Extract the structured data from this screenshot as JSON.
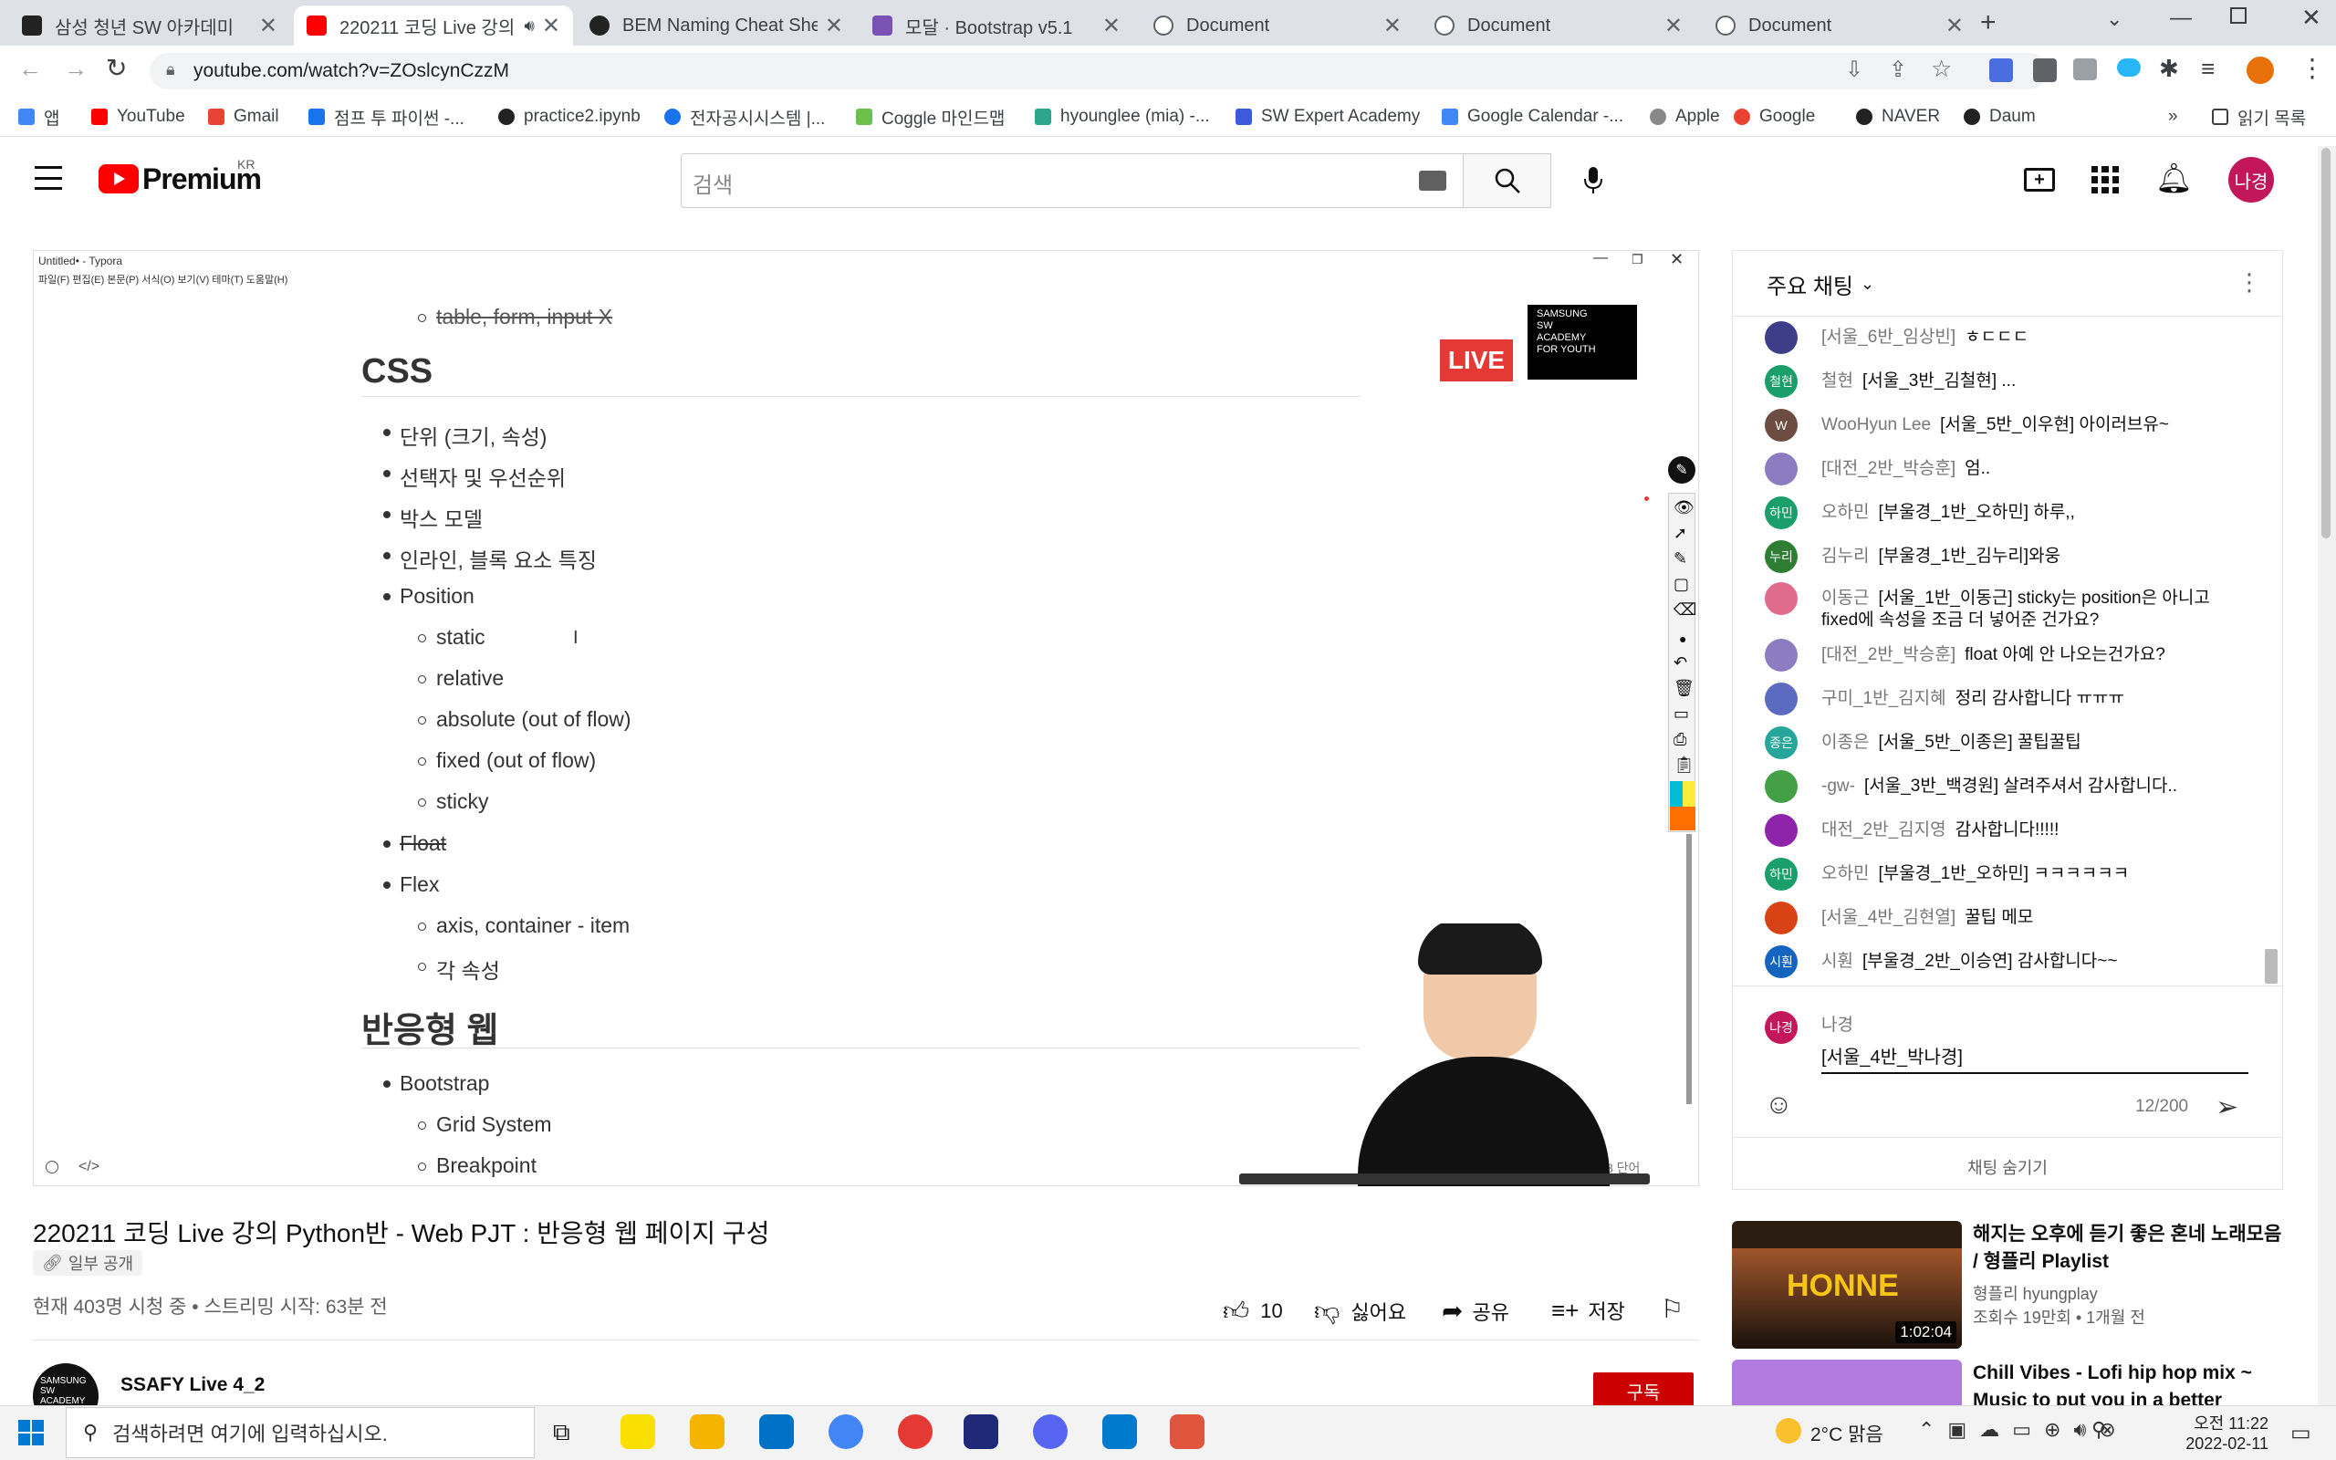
{
  "browser": {
    "tabs": [
      {
        "title": "삼성 청년 SW 아카데미",
        "color": "#222"
      },
      {
        "title": "220211 코딩 Live 강의",
        "color": "#f00"
      },
      {
        "title": "BEM Naming Cheat Shee",
        "color": "#222"
      },
      {
        "title": "모달 · Bootstrap v5.1",
        "color": "#7952b3"
      },
      {
        "title": "Document",
        "color": "#5f6368"
      },
      {
        "title": "Document",
        "color": "#5f6368"
      },
      {
        "title": "Document",
        "color": "#5f6368"
      }
    ],
    "url": "youtube.com/watch?v=ZOslcynCzzM",
    "bookmarks": [
      {
        "label": "앱",
        "color": "#4285f4"
      },
      {
        "label": "YouTube",
        "color": "#f00"
      },
      {
        "label": "Gmail",
        "color": "#ea4335"
      },
      {
        "label": "점프 투 파이썬 -...",
        "color": "#1a73e8"
      },
      {
        "label": "practice2.ipynb",
        "color": "#222"
      },
      {
        "label": "전자공시시스템 |...",
        "color": "#1a73e8"
      },
      {
        "label": "Coggle 마인드맵",
        "color": "#6cc04a"
      },
      {
        "label": "hyounglee (mia) -...",
        "color": "#2ca58d"
      },
      {
        "label": "SW Expert Academy",
        "color": "#3b5bdb"
      },
      {
        "label": "Google Calendar -...",
        "color": "#4285f4"
      },
      {
        "label": "Apple",
        "color": "#888"
      },
      {
        "label": "Google",
        "color": "#ea4335"
      },
      {
        "label": "NAVER",
        "color": "#222"
      },
      {
        "label": "Daum",
        "color": "#222"
      }
    ],
    "reading_list": "읽기 목록",
    "more": "»"
  },
  "youtube": {
    "logo": "Premium",
    "region": "KR",
    "search_placeholder": "검색",
    "avatar": "나경"
  },
  "typora": {
    "title": "Untitled• - Typora",
    "menu": "파일(F)  편집(E)  본문(P)  서식(O)  보기(V)  테마(T)  도움말(H)",
    "lines": {
      "strike1": "table, form, input X",
      "css": "CSS",
      "l1": "단위 (크기, 속성)",
      "l2": "선택자 및 우선순위",
      "l3": "박스 모델",
      "l4": "인라인, 블록 요소 특징",
      "l5": "Position",
      "l5a": "static",
      "l5b": "relative",
      "l5c": "absolute (out of flow)",
      "l5d": "fixed (out of flow)",
      "l5e": "sticky",
      "l6": "Float",
      "l7": "Flex",
      "l7a": "axis, container - item",
      "l7b": "각 속성",
      "resp": "반응형 웹",
      "r1": "Bootstrap",
      "r1a": "Grid System",
      "r1b": "Breakpoint"
    },
    "word_count": "8 단어",
    "live_badge": "LIVE",
    "academy_logo": "SAMSUNG SW ACADEMY FOR YOUTH"
  },
  "video": {
    "title": "220211 코딩 Live 강의 Python반 - Web PJT : 반응형 웹 페이지 구성",
    "visibility": "일부 공개",
    "stats": "현재 403명 시청 중 • 스트리밍 시작: 63분 전",
    "likes": "10",
    "dislike": "싫어요",
    "share": "공유",
    "save": "저장",
    "channel": "SSAFY Live 4_2",
    "subscribe": "구독"
  },
  "chat": {
    "header": "주요 채팅",
    "messages": [
      {
        "av": "",
        "color": "#3d3d8a",
        "author": "[서울_6반_임상빈]",
        "text": "ㅎㄷㄷㄷ"
      },
      {
        "av": "철현",
        "color": "#1a9e6a",
        "author": "철현",
        "text": "[서울_3반_김철현] ..."
      },
      {
        "av": "W",
        "color": "#6d4c41",
        "author": "WooHyun Lee",
        "text": "[서울_5반_이우현] 아이러브유~"
      },
      {
        "av": "",
        "color": "#8e7cc3",
        "author": "[대전_2반_박승훈]",
        "text": "엄.."
      },
      {
        "av": "하민",
        "color": "#1a9e6a",
        "author": "오하민",
        "text": "[부울경_1반_오하민] 하루,,"
      },
      {
        "av": "누리",
        "color": "#2e7d32",
        "author": "김누리",
        "text": "[부울경_1반_김누리]와웅"
      },
      {
        "av": "",
        "color": "#e06b8b",
        "author": "이동근",
        "text": "[서울_1반_이동근] sticky는 position은 아니고 fixed에 속성을 조금 더 넣어준 건가요?"
      },
      {
        "av": "",
        "color": "#8e7cc3",
        "author": "[대전_2반_박승훈]",
        "text": "float 아예 안 나오는건가요?"
      },
      {
        "av": "",
        "color": "#5c6bc0",
        "author": "구미_1반_김지혜",
        "text": "정리 감사합니다 ㅠㅠㅠ"
      },
      {
        "av": "종은",
        "color": "#26a69a",
        "author": "이종은",
        "text": "[서울_5반_이종은] 꿀팁꿀팁"
      },
      {
        "av": "",
        "color": "#43a047",
        "author": "-gw-",
        "text": "[서울_3반_백경원] 살려주셔서 감사합니다.."
      },
      {
        "av": "",
        "color": "#8e24aa",
        "author": "대전_2반_김지영",
        "text": "감사합니다!!!!!"
      },
      {
        "av": "하민",
        "color": "#1a9e6a",
        "author": "오하민",
        "text": "[부울경_1반_오하민] ㅋㅋㅋㅋㅋㅋ"
      },
      {
        "av": "",
        "color": "#d84315",
        "author": "[서울_4반_김현열]",
        "text": "꿀팁 메모"
      },
      {
        "av": "시훤",
        "color": "#1565c0",
        "author": "시훤",
        "text": "[부울경_2반_이승연] 감사합니다~~"
      }
    ],
    "input_author": "나경",
    "input_value": "[서울_4반_박나경]",
    "counter": "12/200",
    "hide": "채팅 숨기기"
  },
  "recommendations": [
    {
      "title": "해지는 오후에 듣기 좋은 혼네 노래모음 / 형플리 Playlist",
      "channel": "형플리 hyungplay",
      "meta": "조회수 19만회 • 1개월 전",
      "duration": "1:02:04",
      "thumb_text": "HONNE"
    },
    {
      "title": "Chill Vibes - Lofi hip hop mix ~ Music to put you in a better",
      "channel": "",
      "meta": "",
      "duration": "",
      "thumb_text": ""
    }
  ],
  "taskbar": {
    "search": "검색하려면 여기에 입력하십시오.",
    "weather": "2°C  맑음",
    "time": "오전 11:22",
    "date": "2022-02-11"
  }
}
